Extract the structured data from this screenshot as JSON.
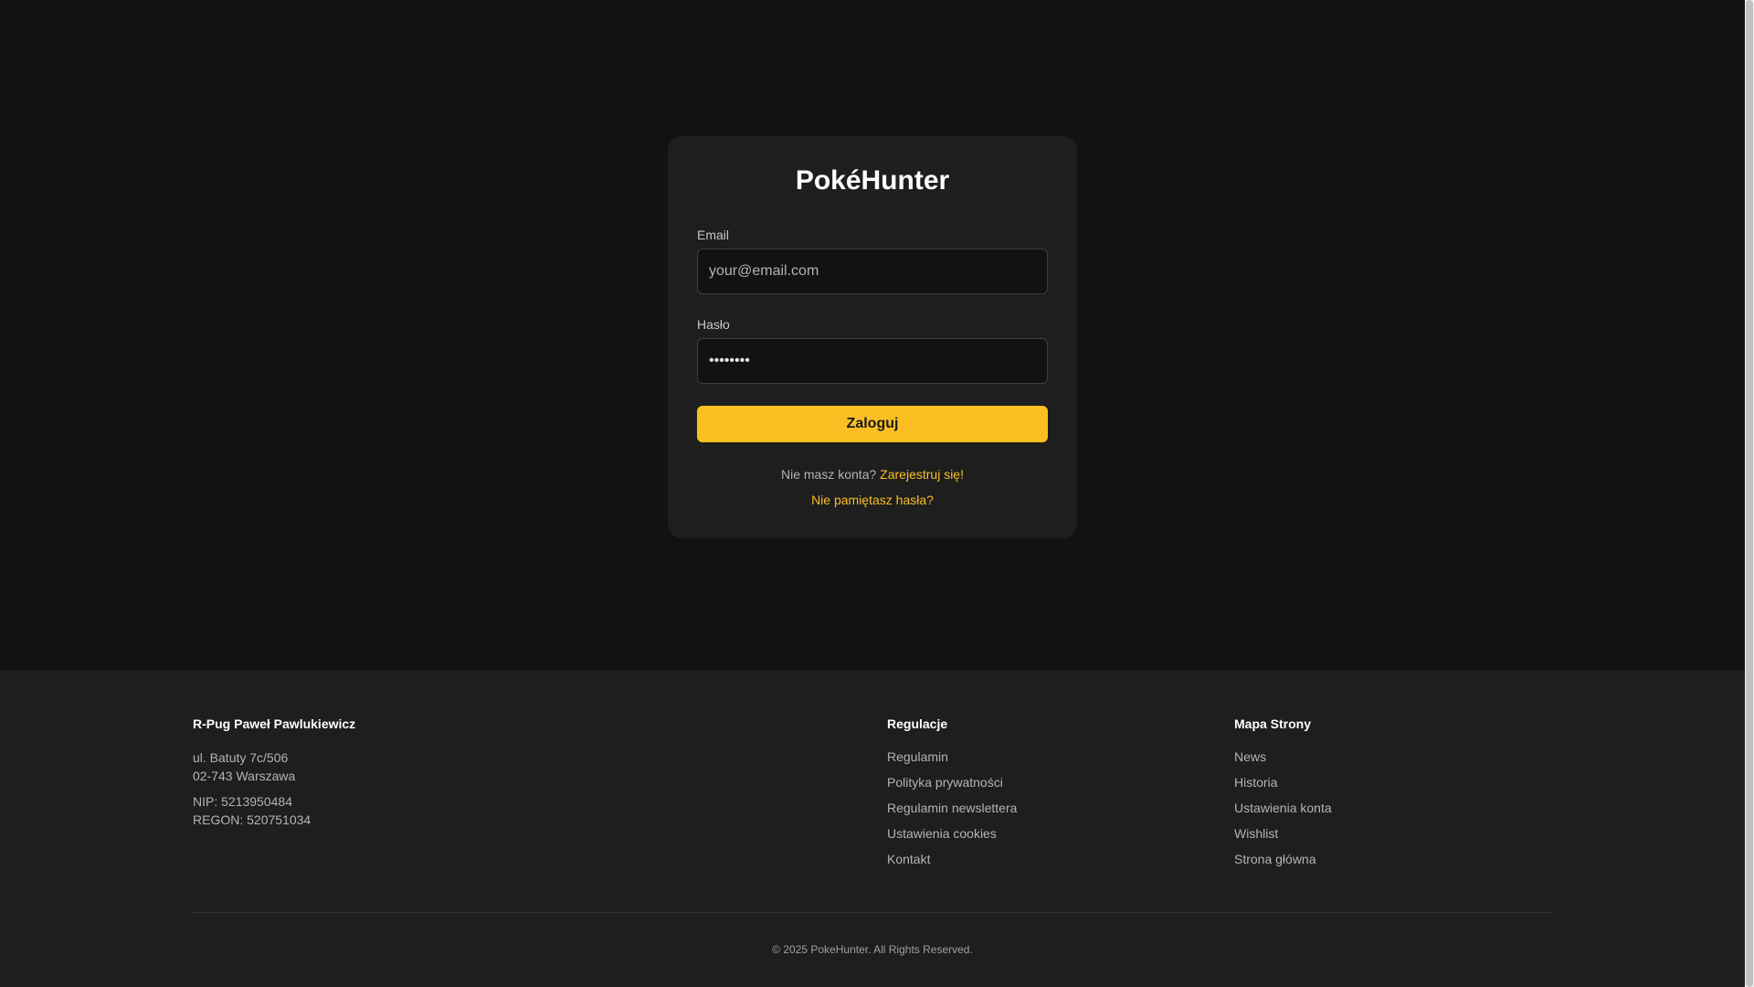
{
  "colors": {
    "accent": "#fbbf24",
    "page_background": "#121212",
    "card_background": "#1e1e1e"
  },
  "login": {
    "title": "PokéHunter",
    "email_label": "Email",
    "email_placeholder": "your@email.com",
    "email_value": "",
    "password_label": "Hasło",
    "password_value": "password",
    "submit_label": "Zaloguj",
    "no_account_text": "Nie masz konta?",
    "register_link": "Zarejestruj się!",
    "forgot_link": "Nie pamiętasz hasła?"
  },
  "footer": {
    "company": {
      "name": "R-Pug Paweł Pawlukiewicz",
      "street": "ul. Batuty 7c/506",
      "city": "02-743 Warszawa",
      "nip": "NIP: 5213950484",
      "regon": "REGON: 520751034"
    },
    "rules": {
      "heading": "Regulacje",
      "links": [
        "Regulamin",
        "Polityka prywatności",
        "Regulamin newslettera",
        "Ustawienia cookies",
        "Kontakt"
      ]
    },
    "sitemap": {
      "heading": "Mapa Strony",
      "links": [
        "News",
        "Historia",
        "Ustawienia konta",
        "Wishlist",
        "Strona główna"
      ]
    },
    "copyright": "© 2025 PokeHunter. All Rights Reserved."
  }
}
